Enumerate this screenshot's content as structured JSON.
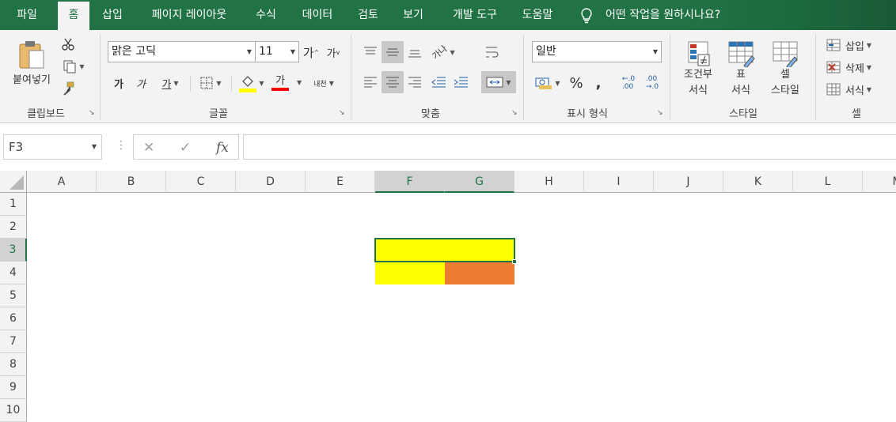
{
  "tabs": [
    "파일",
    "홈",
    "삽입",
    "페이지 레이아웃",
    "수식",
    "데이터",
    "검토",
    "보기",
    "개발 도구",
    "도움말"
  ],
  "tell_me": "어떤 작업을 원하시나요?",
  "clipboard": {
    "paste": "붙여넣기",
    "label": "클립보드"
  },
  "font": {
    "name": "맑은 고딕",
    "size": "11",
    "grow": "가",
    "shrink": "가",
    "bold": "가",
    "italic": "가",
    "underline": "가",
    "color_glyph": "가",
    "phonetic": "내천",
    "label": "글꼴",
    "fill_color": "#ffff00",
    "text_color": "#ff0000"
  },
  "alignment": {
    "label": "맞춤",
    "orientation": "가나"
  },
  "number": {
    "format": "일반",
    "percent": "%",
    "comma": ",",
    "inc_dec": "←.0\n.00",
    "dec_dec": ".00\n→.0",
    "label": "표시 형식"
  },
  "styles": {
    "conditional": "조건부\n서식",
    "table": "표\n서식",
    "cell": "셀\n스타일",
    "label": "스타일"
  },
  "cells": {
    "insert": "삽입",
    "delete": "삭제",
    "format": "서식",
    "label": "셀"
  },
  "name_box": "F3",
  "columns": [
    "A",
    "B",
    "C",
    "D",
    "E",
    "F",
    "G",
    "H",
    "I",
    "J",
    "K",
    "L",
    "M"
  ],
  "rows": [
    "1",
    "2",
    "3",
    "4",
    "5",
    "6",
    "7",
    "8",
    "9",
    "10"
  ],
  "selected_columns": [
    "F",
    "G"
  ],
  "selected_row": "3",
  "colors": {
    "yellow": "#ffff00",
    "orange": "#ed7d31",
    "excel_green": "#217346"
  }
}
